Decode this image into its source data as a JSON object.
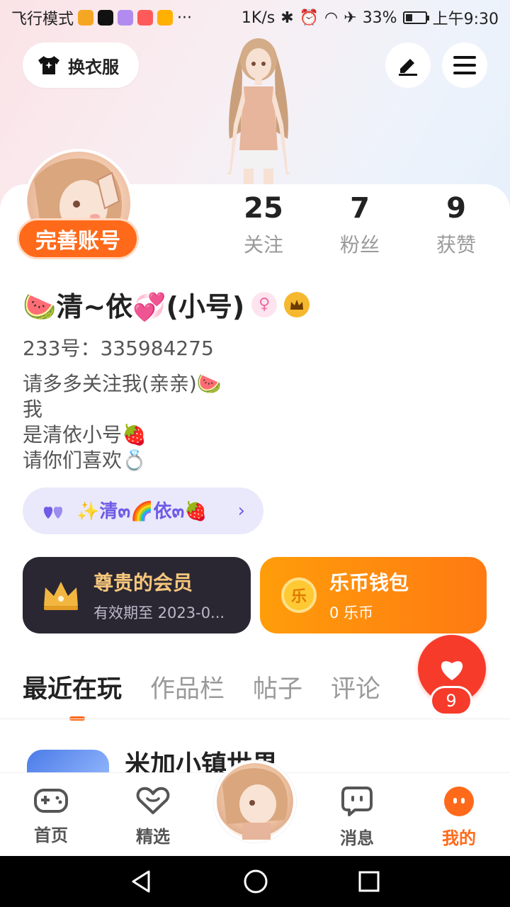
{
  "status_bar": {
    "left_text": "飞行模式",
    "more": "···",
    "speed": "1K/s",
    "battery": "33%",
    "time": "上午9:30"
  },
  "header": {
    "outfit_label": "换衣服",
    "icons": [
      "shirt-icon",
      "edit-icon",
      "menu-icon"
    ]
  },
  "profile": {
    "complete_account_label": "完善账号",
    "stats": [
      {
        "value": "25",
        "label": "关注"
      },
      {
        "value": "7",
        "label": "粉丝"
      },
      {
        "value": "9",
        "label": "获赞"
      }
    ],
    "name": "🍉清~依💞(小号)",
    "uid": "233号：335984275",
    "bio": [
      "请多多关注我(亲亲)🍉",
      "我",
      "是清依小号🍓",
      "请你们喜欢💍"
    ],
    "tag": "✨清๓🌈依๓🍓"
  },
  "vip_card": {
    "title": "尊贵的会员",
    "subtitle": "有效期至 2023-0...",
    "colors": {
      "bg": "#2a2733",
      "title": "#f7c77c"
    }
  },
  "wallet_card": {
    "title": "乐币钱包",
    "subtitle": "0 乐币",
    "coin_glyph": "乐"
  },
  "like_fab": {
    "count": "9"
  },
  "tabs": [
    {
      "label": "最近在玩",
      "active": true
    },
    {
      "label": "作品栏",
      "active": false
    },
    {
      "label": "帖子",
      "active": false
    },
    {
      "label": "评论",
      "active": false
    }
  ],
  "recent": {
    "title": "米加小镇世界"
  },
  "bottom_nav": [
    {
      "label": "首页",
      "icon": "gamepad-icon"
    },
    {
      "label": "精选",
      "icon": "heart-chat-icon"
    },
    {
      "label": "消息",
      "icon": "message-icon"
    },
    {
      "label": "我的",
      "icon": "me-icon",
      "active": true
    }
  ],
  "colors": {
    "accent": "#ff6a1a",
    "like": "#f63b2b",
    "tag_text": "#6e5be6"
  }
}
